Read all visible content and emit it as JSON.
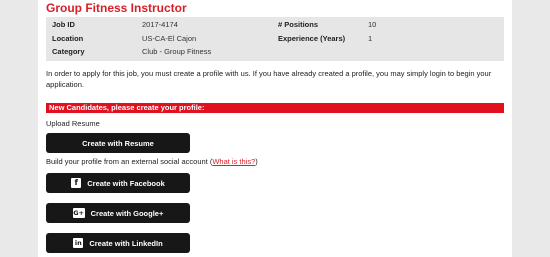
{
  "job": {
    "title": "Group Fitness Instructor",
    "fields": {
      "job_id_label": "Job ID",
      "job_id_value": "2017-4174",
      "location_label": "Location",
      "location_value": "US-CA-El Cajon",
      "category_label": "Category",
      "category_value": "Club - Group Fitness",
      "positions_label": "# Positions",
      "positions_value": "10",
      "experience_label": "Experience (Years)",
      "experience_value": "1"
    }
  },
  "intro_text": "In order to apply for this job, you must create a profile with us. If you have already created a profile, you may simply login to begin your application.",
  "new_candidates_bar": "New Candidates, please create your profile:",
  "upload": {
    "label": "Upload Resume",
    "button": "Create with Resume"
  },
  "social": {
    "prompt": "Build your profile from an external social account",
    "whats_this_link": "What is this?",
    "buttons": [
      {
        "label": "Create with Facebook",
        "icon": "facebook-icon",
        "glyph": "f"
      },
      {
        "label": "Create with Google+",
        "icon": "google-plus-icon",
        "glyph": "G+"
      },
      {
        "label": "Create with LinkedIn",
        "icon": "linkedin-icon",
        "glyph": "in"
      }
    ]
  },
  "colors": {
    "accent_red": "#d9202a",
    "bar_red": "#e0101e",
    "button_black": "#171717"
  }
}
